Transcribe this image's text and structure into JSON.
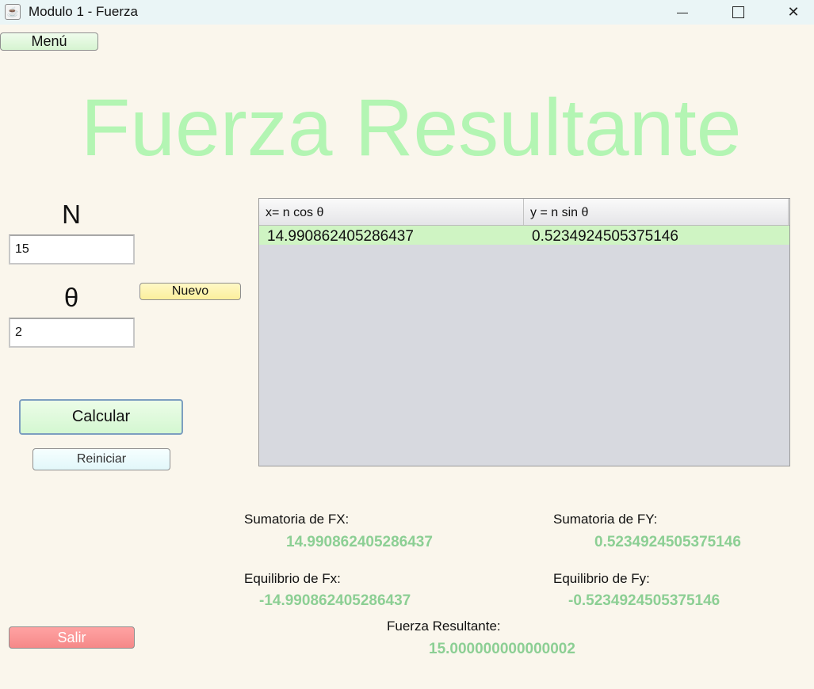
{
  "window": {
    "title": "Modulo 1 - Fuerza",
    "icon": "java-cup-icon",
    "controls": {
      "minimize": "minimize-icon",
      "maximize": "maximize-icon",
      "close": "✕"
    }
  },
  "menu": {
    "label": "Menú"
  },
  "heading": "Fuerza Resultante",
  "inputs": {
    "n_label": "N",
    "n_value": "15",
    "theta_label": "θ",
    "theta_value": "2"
  },
  "buttons": {
    "nuevo": "Nuevo",
    "calcular": "Calcular",
    "reiniciar": "Reiniciar",
    "salir": "Salir"
  },
  "table": {
    "columns": [
      "x= n cos θ",
      "y = n sin θ"
    ],
    "rows": [
      [
        "14.990862405286437",
        "0.5234924505375146"
      ]
    ]
  },
  "results": {
    "sum_fx_label": "Sumatoria de FX:",
    "sum_fx_value": "14.990862405286437",
    "sum_fy_label": "Sumatoria de FY:",
    "sum_fy_value": "0.5234924505375146",
    "eq_fx_label": "Equilibrio de Fx:",
    "eq_fx_value": "-14.990862405286437",
    "eq_fy_label": "Equilibrio de Fy:",
    "eq_fy_value": "-0.5234924505375146",
    "resultant_label": "Fuerza Resultante:",
    "resultant_value": "15.000000000000002"
  },
  "colors": {
    "background": "#faf6ec",
    "heading": "#b3f5b3",
    "value_text": "#8ccf94",
    "selected_row": "#cff4c3",
    "exit_button": "#f58888"
  }
}
